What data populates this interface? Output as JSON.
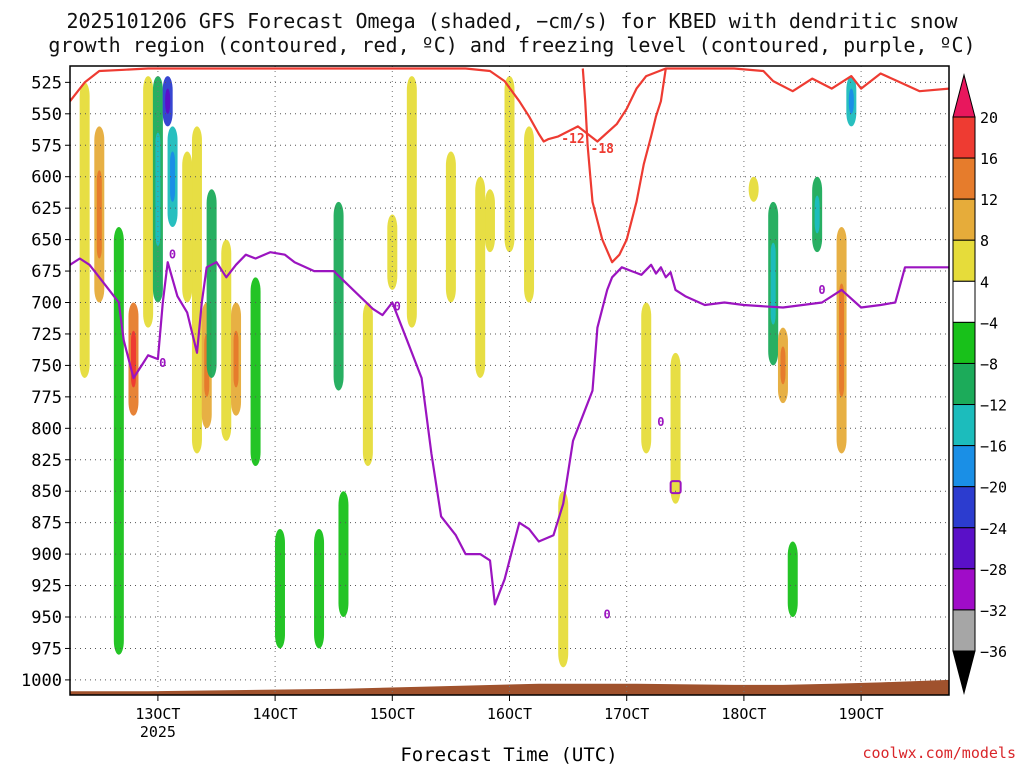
{
  "title_line1": "2025101206 GFS Forecast Omega (shaded, −cm/s) for KBED with dendritic snow",
  "title_line2": "growth region (contoured, red, ºC) and freezing level (contoured, purple, ºC)",
  "xlabel": "Forecast Time (UTC)",
  "credit": "coolwx.com/models",
  "chart_data": {
    "type": "heatmap",
    "title": "2025101206 GFS Forecast Omega (shaded, −cm/s) for KBED with dendritic snow growth region (contoured, red, ºC) and freezing level (contoured, purple, ºC)",
    "xlabel": "Forecast Time (UTC)",
    "ylabel": "",
    "x_ticks": [
      "13OCT",
      "14OCT",
      "15OCT",
      "16OCT",
      "17OCT",
      "18OCT",
      "19OCT"
    ],
    "x_tick_hours": [
      72,
      96,
      120,
      144,
      168,
      192,
      216
    ],
    "x_year_label": "2025",
    "xlim_hours": [
      54,
      234
    ],
    "y_ticks": [
      525,
      550,
      575,
      600,
      625,
      650,
      675,
      700,
      725,
      750,
      775,
      800,
      825,
      850,
      875,
      900,
      925,
      950,
      975,
      1000
    ],
    "ylim_hPa": [
      1012,
      512
    ],
    "grid": true,
    "colorbar": {
      "labels": [
        "20",
        "16",
        "12",
        "8",
        "4",
        "−4",
        "−8",
        "−12",
        "−16",
        "−20",
        "−24",
        "−28",
        "−32",
        "−36"
      ],
      "bounds": [
        20,
        16,
        12,
        8,
        4,
        -4,
        -8,
        -12,
        -16,
        -20,
        -24,
        -28,
        -32,
        -36
      ],
      "colors": [
        "#e8175d",
        "#ee3b32",
        "#e67c2c",
        "#e6ac3a",
        "#e6dc3a",
        "#ffffff",
        "#18c11a",
        "#1cab5a",
        "#1cbcbc",
        "#1a8fe6",
        "#2c3ccf",
        "#5a10c8",
        "#a00cc8",
        "#a6a6a6",
        "#000000"
      ]
    },
    "omega_features": [
      {
        "x": 57,
        "p_top": 525,
        "p_bot": 760,
        "value": 6
      },
      {
        "x": 60,
        "p_top": 560,
        "p_bot": 700,
        "value": 12
      },
      {
        "x": 64,
        "p_top": 640,
        "p_bot": 980,
        "value": -6
      },
      {
        "x": 67,
        "p_top": 700,
        "p_bot": 790,
        "value": 14
      },
      {
        "x": 70,
        "p_top": 520,
        "p_bot": 720,
        "value": 6
      },
      {
        "x": 72,
        "p_top": 520,
        "p_bot": 700,
        "value": -10
      },
      {
        "x": 74,
        "p_top": 520,
        "p_bot": 560,
        "value": -22
      },
      {
        "x": 75,
        "p_top": 560,
        "p_bot": 640,
        "value": -14
      },
      {
        "x": 78,
        "p_top": 580,
        "p_bot": 700,
        "value": 6
      },
      {
        "x": 80,
        "p_top": 560,
        "p_bot": 820,
        "value": 6
      },
      {
        "x": 82,
        "p_top": 700,
        "p_bot": 800,
        "value": 12
      },
      {
        "x": 83,
        "p_top": 610,
        "p_bot": 760,
        "value": -8
      },
      {
        "x": 86,
        "p_top": 650,
        "p_bot": 810,
        "value": 6
      },
      {
        "x": 88,
        "p_top": 700,
        "p_bot": 790,
        "value": 12
      },
      {
        "x": 92,
        "p_top": 680,
        "p_bot": 830,
        "value": -6
      },
      {
        "x": 97,
        "p_top": 880,
        "p_bot": 975,
        "value": -6
      },
      {
        "x": 105,
        "p_top": 880,
        "p_bot": 975,
        "value": -6
      },
      {
        "x": 109,
        "p_top": 620,
        "p_bot": 770,
        "value": -8
      },
      {
        "x": 110,
        "p_top": 850,
        "p_bot": 950,
        "value": -6
      },
      {
        "x": 115,
        "p_top": 700,
        "p_bot": 830,
        "value": 6
      },
      {
        "x": 120,
        "p_top": 630,
        "p_bot": 690,
        "value": 6
      },
      {
        "x": 124,
        "p_top": 520,
        "p_bot": 720,
        "value": 8
      },
      {
        "x": 132,
        "p_top": 580,
        "p_bot": 700,
        "value": 6
      },
      {
        "x": 138,
        "p_top": 600,
        "p_bot": 760,
        "value": 5
      },
      {
        "x": 140,
        "p_top": 610,
        "p_bot": 660,
        "value": 8
      },
      {
        "x": 144,
        "p_top": 520,
        "p_bot": 660,
        "value": 8
      },
      {
        "x": 148,
        "p_top": 560,
        "p_bot": 700,
        "value": 6
      },
      {
        "x": 155,
        "p_top": 850,
        "p_bot": 990,
        "value": 6
      },
      {
        "x": 172,
        "p_top": 700,
        "p_bot": 820,
        "value": 6
      },
      {
        "x": 178,
        "p_top": 740,
        "p_bot": 860,
        "value": 6
      },
      {
        "x": 194,
        "p_top": 600,
        "p_bot": 620,
        "value": 6
      },
      {
        "x": 198,
        "p_top": 620,
        "p_bot": 750,
        "value": -10
      },
      {
        "x": 200,
        "p_top": 720,
        "p_bot": 780,
        "value": 12
      },
      {
        "x": 202,
        "p_top": 890,
        "p_bot": 950,
        "value": -6
      },
      {
        "x": 207,
        "p_top": 600,
        "p_bot": 660,
        "value": -10
      },
      {
        "x": 212,
        "p_top": 640,
        "p_bot": 820,
        "value": 10
      },
      {
        "x": 214,
        "p_top": 520,
        "p_bot": 560,
        "value": -12
      }
    ],
    "dendritic_contours": [
      {
        "label": "-12",
        "color": "#ee3b32",
        "x": [
          54,
          57,
          60,
          65,
          70,
          80,
          100,
          120,
          135,
          140,
          143,
          146,
          148,
          150,
          151,
          152,
          154,
          156,
          158,
          160,
          162,
          166,
          168,
          170,
          172,
          176,
          180,
          184,
          190,
          196,
          198,
          202,
          206,
          210,
          214,
          216,
          220,
          224,
          228,
          234
        ],
        "p": [
          540,
          525,
          516,
          515,
          514,
          514,
          514,
          514,
          514,
          516,
          524,
          540,
          552,
          566,
          572,
          570,
          568,
          564,
          560,
          566,
          572,
          558,
          546,
          530,
          520,
          514,
          514,
          514,
          514,
          516,
          524,
          532,
          522,
          530,
          520,
          530,
          518,
          525,
          532,
          530
        ]
      },
      {
        "label": "-18",
        "color": "#ee3b32",
        "x": [
          159,
          159.5,
          160,
          161,
          163,
          165,
          166.5,
          168,
          170,
          171.5,
          173,
          174,
          175,
          176
        ],
        "p": [
          514,
          540,
          575,
          620,
          650,
          668,
          662,
          650,
          620,
          590,
          568,
          552,
          540,
          514
        ]
      }
    ],
    "freezing_level": {
      "label": "0",
      "color": "#9b14c0",
      "x": [
        54,
        56,
        58,
        60,
        62,
        64,
        65,
        67,
        69,
        70,
        72,
        73,
        74,
        76,
        78,
        80,
        81,
        82,
        84,
        86,
        88,
        90,
        92,
        95,
        98,
        100,
        104,
        108,
        112,
        116,
        118,
        120,
        123,
        126,
        128,
        130,
        133,
        135,
        138,
        140,
        141,
        143,
        146,
        148,
        150,
        153,
        155,
        157,
        159,
        161,
        162,
        164,
        165,
        167,
        169,
        171,
        173,
        174,
        175,
        176,
        177,
        178,
        180,
        184,
        188,
        192,
        196,
        200,
        204,
        208,
        212,
        216,
        220,
        223,
        225,
        234
      ],
      "p": [
        670,
        665,
        670,
        680,
        690,
        700,
        730,
        760,
        748,
        742,
        745,
        700,
        668,
        695,
        708,
        740,
        700,
        672,
        668,
        680,
        670,
        662,
        665,
        660,
        662,
        668,
        675,
        675,
        690,
        705,
        710,
        700,
        730,
        760,
        820,
        870,
        885,
        900,
        900,
        905,
        940,
        920,
        875,
        880,
        890,
        885,
        860,
        810,
        790,
        770,
        720,
        690,
        680,
        672,
        675,
        678,
        670,
        677,
        672,
        680,
        676,
        690,
        695,
        702,
        700,
        702,
        703,
        704,
        702,
        700,
        690,
        704,
        702,
        700,
        672,
        672
      ]
    },
    "surface_terrain": {
      "color": "#a0522d",
      "x": [
        54,
        70,
        90,
        110,
        130,
        150,
        170,
        190,
        200,
        210,
        220,
        234
      ],
      "p": [
        1009,
        1009,
        1008,
        1007,
        1005,
        1003,
        1003,
        1004,
        1004,
        1003,
        1002,
        1000
      ]
    }
  }
}
